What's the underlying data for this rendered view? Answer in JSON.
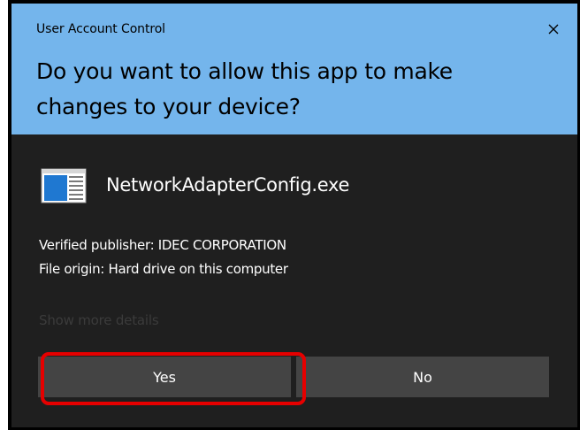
{
  "dialog": {
    "window_title": "User Account Control",
    "question": "Do you want to allow this app to make changes to your device?",
    "app_name": "NetworkAdapterConfig.exe",
    "publisher_line": "Verified publisher: IDEC CORPORATION",
    "origin_line": "File origin: Hard drive on this computer",
    "details_link": "Show more details",
    "yes_label": "Yes",
    "no_label": "No",
    "close_icon": "close-icon",
    "app_icon": "application-window-icon"
  },
  "colors": {
    "header_bg": "#74b5ec",
    "body_bg": "#1f1f1f",
    "button_bg": "#444444",
    "highlight": "#e60000"
  }
}
